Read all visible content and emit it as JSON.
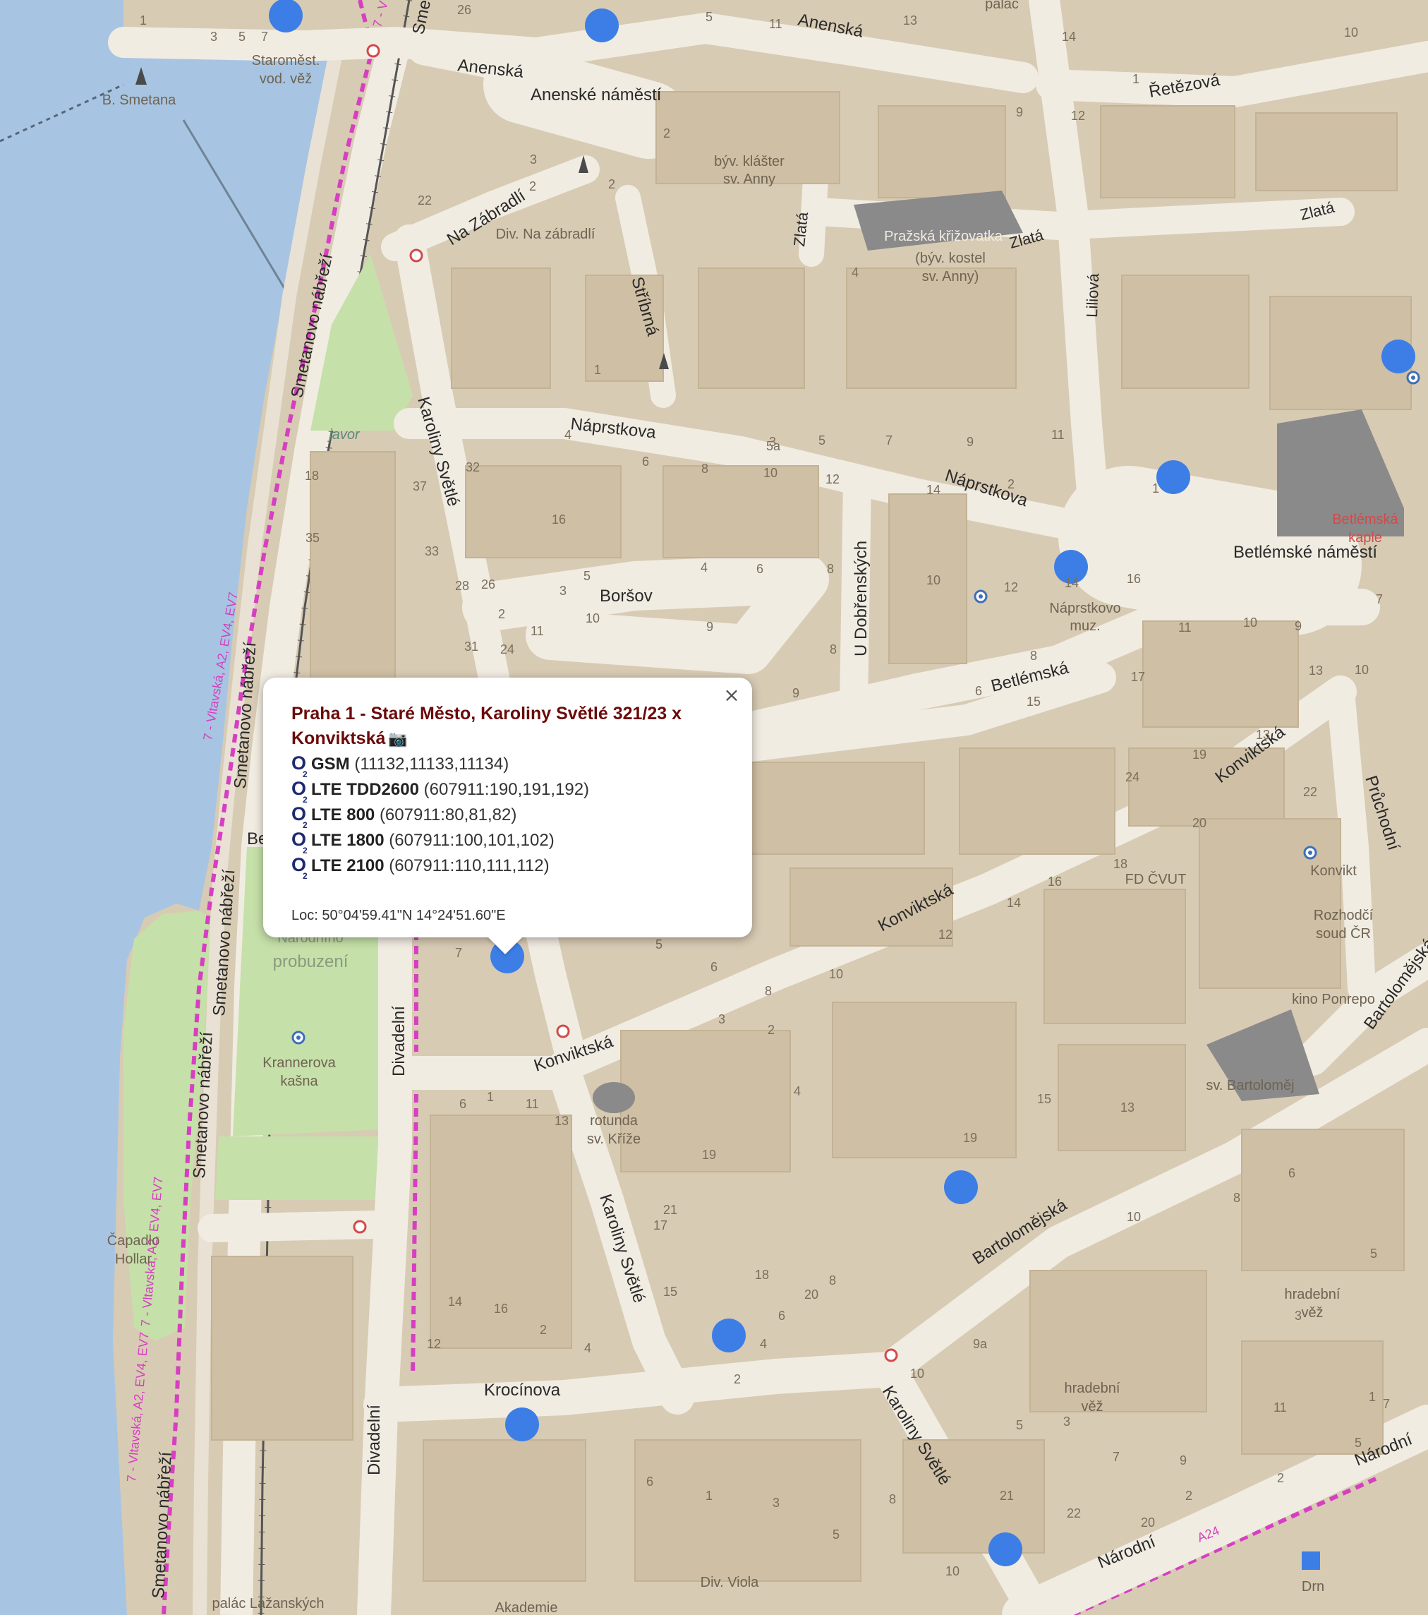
{
  "colors": {
    "river": "#a7c5e2",
    "block": "#d8cbb4",
    "street": "#f1ece2",
    "building": "#cfbfa4",
    "park": "#c6e0a9",
    "dark_building": "#8a8a8a",
    "cell_marker": "#3d7ee6",
    "cycle_route": "#d63fc1",
    "poi_red": "#d14a4a",
    "popup_title": "#6b0a0a",
    "o2_logo": "#1c2a73"
  },
  "streets": {
    "anenska_1": "Anenská",
    "anenska_2": "Anenská",
    "anenske_namesti": "Anenské náměstí",
    "na_zabradli": "Na Zábradlí",
    "stribrna": "Stříbrná",
    "zlata_1": "Zlatá",
    "zlata_2": "Zlatá",
    "zlata_3": "Zlatá",
    "liliova": "Liliová",
    "retezova": "Řetězová",
    "naprstkova_1": "Náprstkova",
    "naprstkova_2": "Náprstkova",
    "karoliny_svetle_1": "Karoliny Světlé",
    "karoliny_svetle_2": "Karoliny Světlé",
    "karoliny_svetle_3": "Karoliny Světlé",
    "borsov": "Boršov",
    "u_dobrenskych": "U Dobřenských",
    "betlemska": "Betlémská",
    "betlemske_namesti": "Betlémské náměstí",
    "konviktska_1": "Konviktská",
    "konviktska_2": "Konviktská",
    "konviktska_3": "Konviktská",
    "pruchodni": "Průchodní",
    "bartolomejska_1": "Bartolomějská",
    "bartolomejska_2": "Bartolomějská",
    "divadelni_1": "Divadelní",
    "divadelni_2": "Divadelní",
    "krocinova": "Krocínova",
    "narodni_1": "Národní",
    "narodni_2": "Národní",
    "smetanovo_1": "Smetanovo nábřeží",
    "smetanovo_2": "Smetanovo nábřeží",
    "smetanovo_3": "Smetanovo nábřeží",
    "smetanovo_4": "Smetanovo nábřeží",
    "smetanovo_5": "Smetanovo nábřeží",
    "smetanovo_top": "Sme",
    "be_partial": "Be",
    "cycle_route_1": "7 - Vltavská, A2, EV4, EV7",
    "cycle_route_2": "7 - Vltavská, A2, EV4, EV7",
    "cycle_route_3": "7 - Vltavská, A2, EV4, EV7",
    "cycle_top": "7 - V",
    "cycle_a24": "A24"
  },
  "pois": {
    "staromest_line1": "Staroměst.",
    "staromest_line2": "vod. věž",
    "b_smetana": "B. Smetana",
    "klaster_line1": "býv. klášter",
    "klaster_line2": "sv. Anny",
    "div_na_zabradli": "Div. Na zábradlí",
    "krizovatka_line1": "Pražská křižovatka",
    "krizovatka_line2": "(býv. kostel",
    "krizovatka_line3": "sv. Anny)",
    "javor": "javor",
    "betlemska_kaple_line1": "Betlémská",
    "betlemska_kaple_line2": "kaple",
    "naprstkovo_line1": "Náprstkovo",
    "naprstkovo_line2": "muz.",
    "fd_cvut": "FD ČVUT",
    "konvikt": "Konvikt",
    "rozhodci_line1": "Rozhodčí",
    "rozhodci_line2": "soud ČR",
    "kino_ponrepo": "kino Ponrepo",
    "sv_bartolomej": "sv. Bartoloměj",
    "narodni_probuzeni_line1": "Národního",
    "narodni_probuzeni_line2": "probuzení",
    "krannerova_line1": "Krannerova",
    "krannerova_line2": "kašna",
    "rotunda_line1": "rotunda",
    "rotunda_line2": "sv. Kříže",
    "capadlo_line1": "Čapadlo",
    "capadlo_line2": "Hollar",
    "hradebni_vez_1_line1": "hradební",
    "hradebni_vez_1_line2": "věž",
    "hradebni_vez_2_line1": "hradební",
    "hradebni_vez_2_line2": "věž",
    "palac_lazanskych": "palác Lažanských",
    "akademie": "Akademie",
    "div_viola": "Div. Viola",
    "drn": "Drn",
    "palac_top": "palác"
  },
  "house_numbers": [
    "1",
    "3",
    "5",
    "7",
    "26",
    "5",
    "11",
    "13",
    "14",
    "10",
    "1",
    "9",
    "12",
    "2",
    "22",
    "2",
    "3",
    "2",
    "1",
    "4",
    "3",
    "5a",
    "5",
    "7",
    "9",
    "11",
    "18",
    "37",
    "32",
    "4",
    "6",
    "8",
    "10",
    "12",
    "14",
    "2",
    "1",
    "16",
    "35",
    "33",
    "28",
    "26",
    "2",
    "3",
    "5",
    "4",
    "6",
    "8",
    "10",
    "12",
    "14",
    "16",
    "31",
    "24",
    "11",
    "10",
    "9",
    "8",
    "9",
    "11",
    "10",
    "9",
    "7",
    "13",
    "10",
    "8",
    "6",
    "17",
    "15",
    "13",
    "19",
    "24",
    "22",
    "20",
    "18",
    "16",
    "14",
    "12",
    "10",
    "8",
    "6",
    "5",
    "3",
    "7",
    "2",
    "4",
    "19",
    "15",
    "13",
    "10",
    "8",
    "6",
    "3",
    "5",
    "1",
    "11",
    "9",
    "7",
    "3",
    "5",
    "9a",
    "10",
    "8",
    "6",
    "4",
    "2",
    "21",
    "19",
    "17",
    "15",
    "13",
    "11",
    "1",
    "6",
    "7",
    "5",
    "2",
    "2",
    "20",
    "22",
    "21",
    "10",
    "8",
    "5",
    "3",
    "1",
    "6",
    "4",
    "2",
    "16",
    "14",
    "12",
    "18",
    "20"
  ],
  "popup": {
    "title": "Praha 1 - Staré Město, Karoliny Světlé 321/23 x Konviktská",
    "camera_icon": "📷",
    "close": "×",
    "o2_letter": "O",
    "o2_sub": "2",
    "techs": [
      {
        "name": "GSM",
        "ids": "(11132,11133,11134)"
      },
      {
        "name": "LTE TDD2600",
        "ids": "(607911:190,191,192)"
      },
      {
        "name": "LTE 800",
        "ids": "(607911:80,81,82)"
      },
      {
        "name": "LTE 1800",
        "ids": "(607911:100,101,102)"
      },
      {
        "name": "LTE 2100",
        "ids": "(607911:110,111,112)"
      }
    ],
    "location": "Loc: 50°04'59.41\"N 14°24'51.60\"E"
  }
}
